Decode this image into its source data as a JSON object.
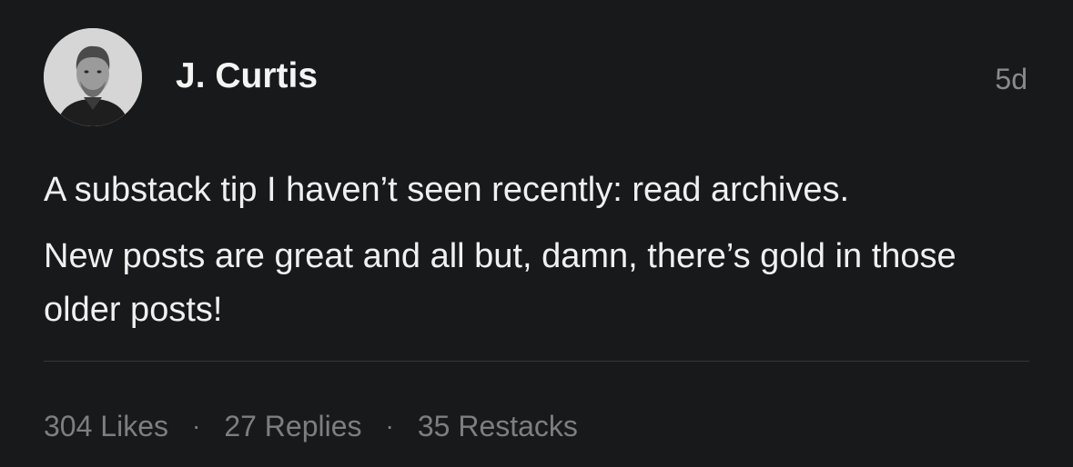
{
  "note": {
    "author": "J. Curtis",
    "timestamp": "5d",
    "avatar_icon": "profile-photo",
    "paragraphs": [
      "A substack tip I haven’t seen recently: read archives.",
      "New posts are great and all but, damn, there’s gold in those older posts!"
    ],
    "stats": {
      "likes": "304 Likes",
      "replies": "27 Replies",
      "restacks": "35 Restacks",
      "separator": "·"
    }
  },
  "colors": {
    "background": "#18191b",
    "text": "#f0f0f0",
    "muted": "#7e7e7e"
  }
}
